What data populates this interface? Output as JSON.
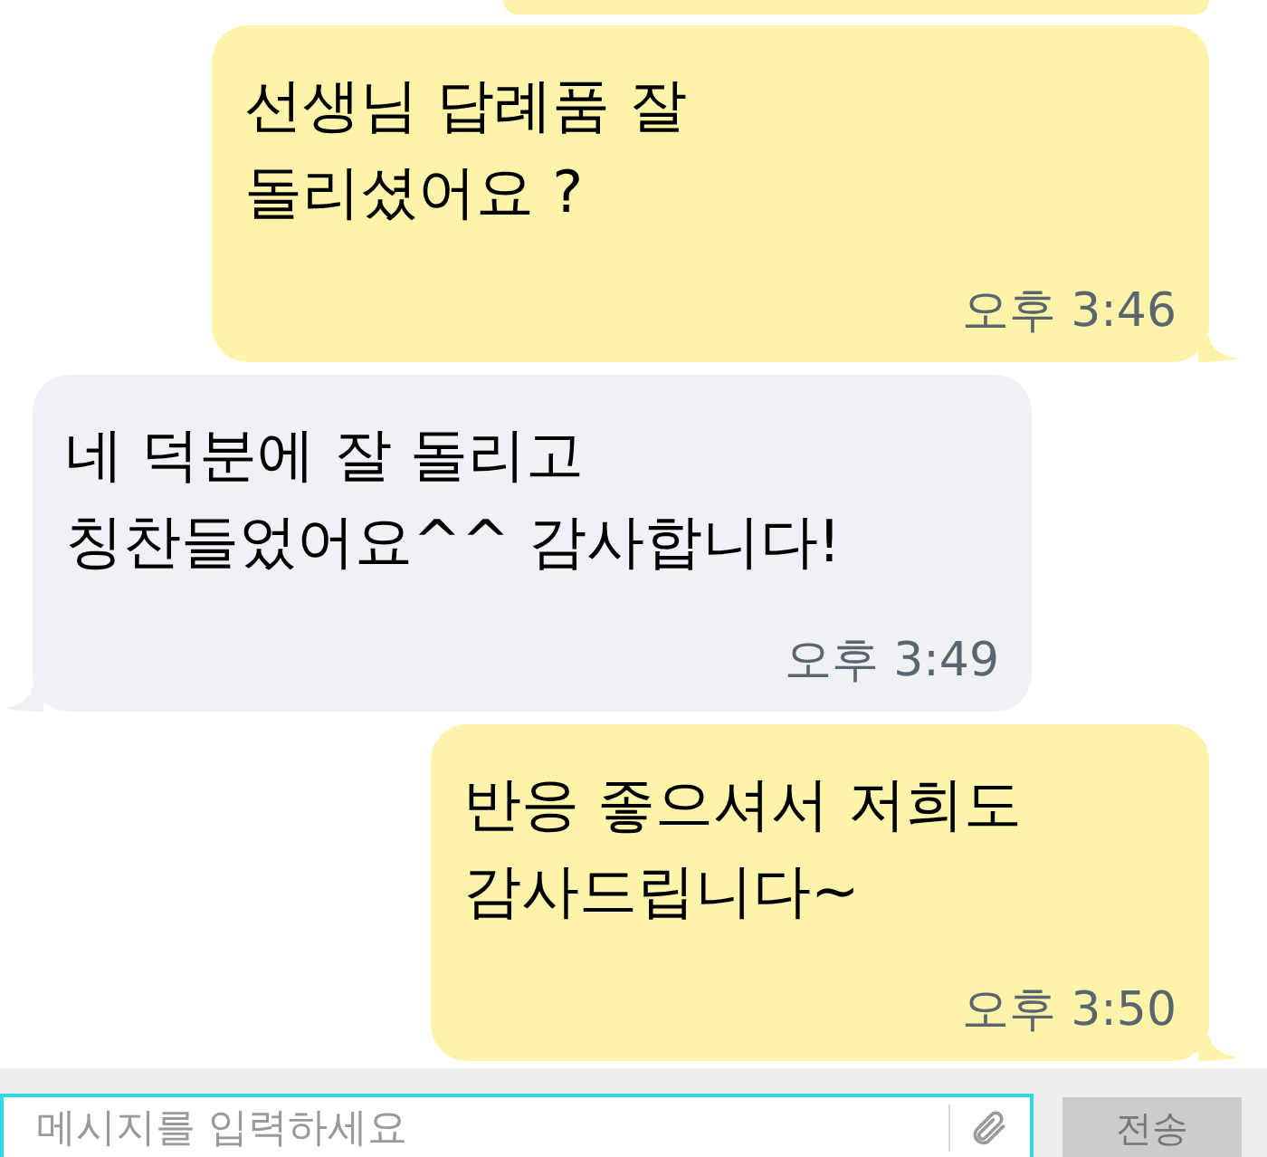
{
  "messages": [
    {
      "kind": "sent",
      "lines": [
        "선생님 답례품 잘",
        "돌리셨어요  ?"
      ],
      "time": "오후 3:46"
    },
    {
      "kind": "received",
      "lines": [
        "네 덕분에 잘 돌리고",
        "칭찬들었어요^^ 감사합니다!"
      ],
      "time": "오후 3:49"
    },
    {
      "kind": "sent",
      "lines": [
        "반응 좋으셔서  저희도",
        "감사드립니다~"
      ],
      "time": "오후 3:50"
    }
  ],
  "composer": {
    "placeholder": "메시지를 입력하세요",
    "send": "전송"
  }
}
